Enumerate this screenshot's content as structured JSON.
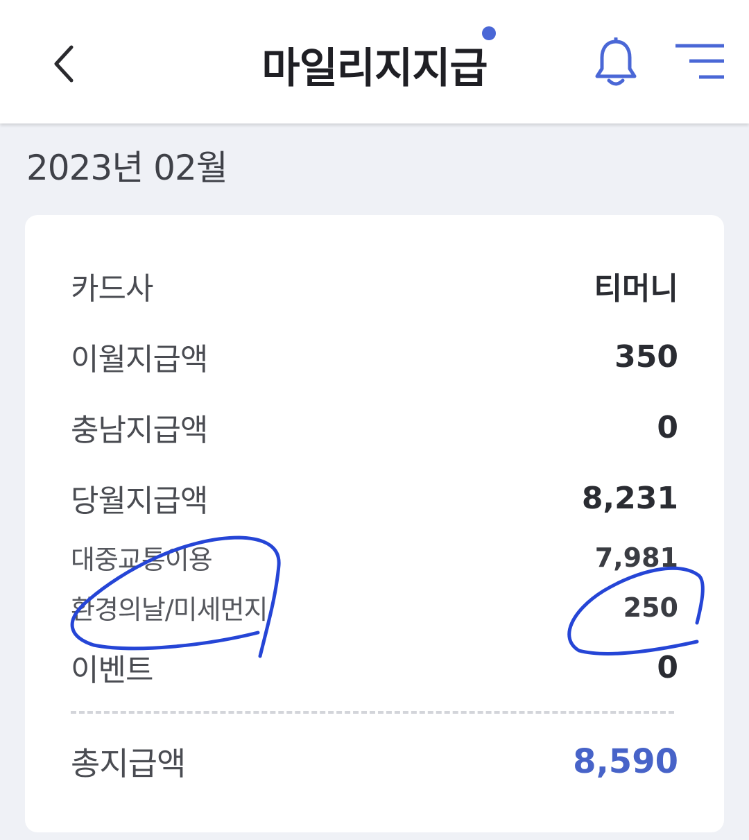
{
  "header": {
    "title": "마일리지지급",
    "back_icon": "chevron-left-icon",
    "bell_icon": "bell-icon",
    "menu_icon": "menu-icon",
    "accent_color": "#4a67d6"
  },
  "month_label": "2023년 02월",
  "rows": [
    {
      "label": "카드사",
      "value": "티머니"
    },
    {
      "label": "이월지급액",
      "value": "350"
    },
    {
      "label": "충남지급액",
      "value": "0"
    },
    {
      "label": "당월지급액",
      "value": "8,231"
    },
    {
      "label": "대중교통이용",
      "value": "7,981"
    },
    {
      "label": "환경의날/미세먼지",
      "value": "250"
    },
    {
      "label": "이벤트",
      "value": "0"
    }
  ],
  "total": {
    "label": "총지급액",
    "value": "8,590",
    "color": "#4763c8"
  }
}
